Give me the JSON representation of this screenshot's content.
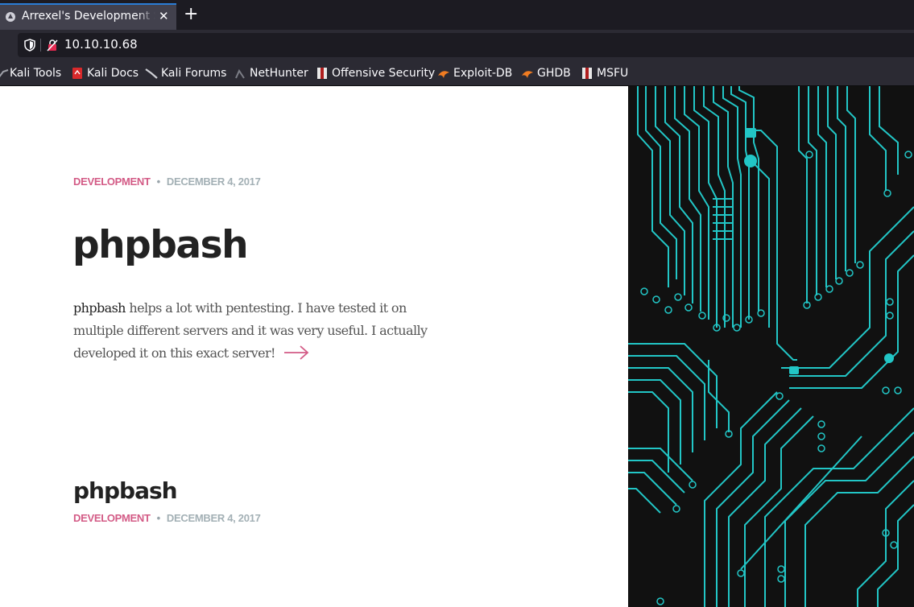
{
  "browser": {
    "tab_title": "Arrexel's Development Site",
    "new_tab_icon": "plus-icon",
    "url": "10.10.10.68",
    "bookmarks": [
      "Kali Tools",
      "Kali Docs",
      "Kali Forums",
      "NetHunter",
      "Offensive Security",
      "Exploit-DB",
      "GHDB",
      "MSFU"
    ]
  },
  "post": {
    "category": "DEVELOPMENT",
    "separator": "•",
    "date": "DECEMBER 4, 2017",
    "title": "phpbash",
    "excerpt_lead": "phpbash",
    "excerpt_rest": " helps a lot with pentesting. I have tested it on multiple different servers and it was very useful. I actually developed it on this exact server!"
  },
  "post2": {
    "title": "phpbash",
    "category": "DEVELOPMENT",
    "separator": "•",
    "date": "DECEMBER 4, 2017"
  },
  "colors": {
    "accent": "#d35b86",
    "date": "#a3b0b5",
    "circuit": "#22c6c6",
    "circuit_bg": "#111111"
  }
}
